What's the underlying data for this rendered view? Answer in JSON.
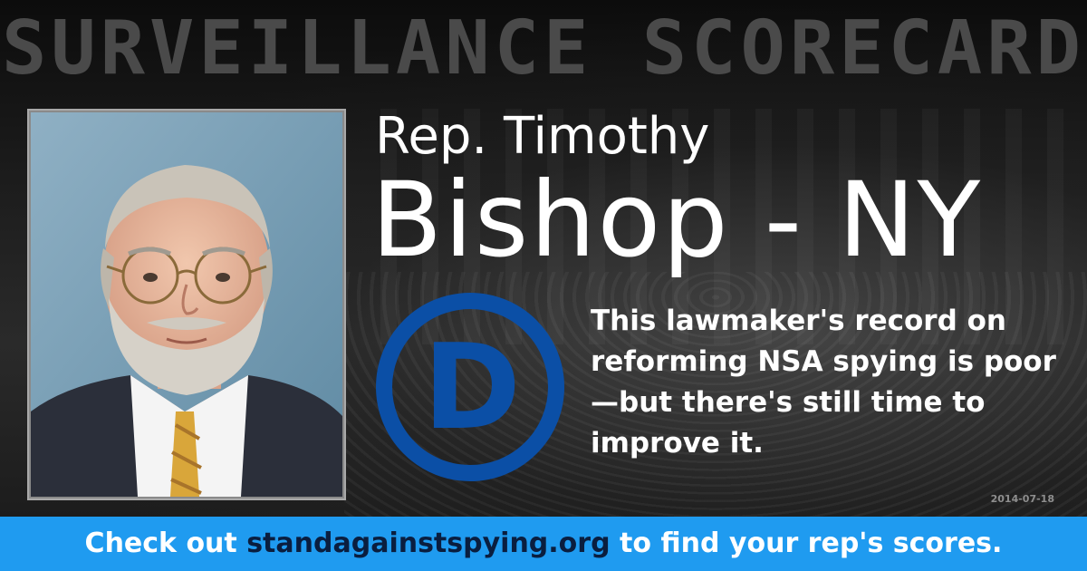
{
  "header": {
    "title": "SURVEILLANCE SCORECARD"
  },
  "profile": {
    "name_line1": "Rep. Timothy",
    "name_line2": "Bishop - NY",
    "party_letter": "D",
    "statement": "This lawmaker's record on reforming NSA spying is poor—but there's still time to improve it.",
    "date": "2014-07-18"
  },
  "cta": {
    "prefix": "Check out ",
    "link": "standagainstspying.org",
    "suffix": " to find your rep's scores."
  },
  "icons": {
    "party_logo": "democratic-party-logo-icon",
    "portrait": "portrait-photo"
  },
  "colors": {
    "background": "#1c1c1c",
    "header_text": "#4a4a4a",
    "party_blue": "#0b4fa6",
    "cta_bar": "#1f9bf0",
    "cta_link": "#0a1e3f",
    "text": "#ffffff"
  }
}
